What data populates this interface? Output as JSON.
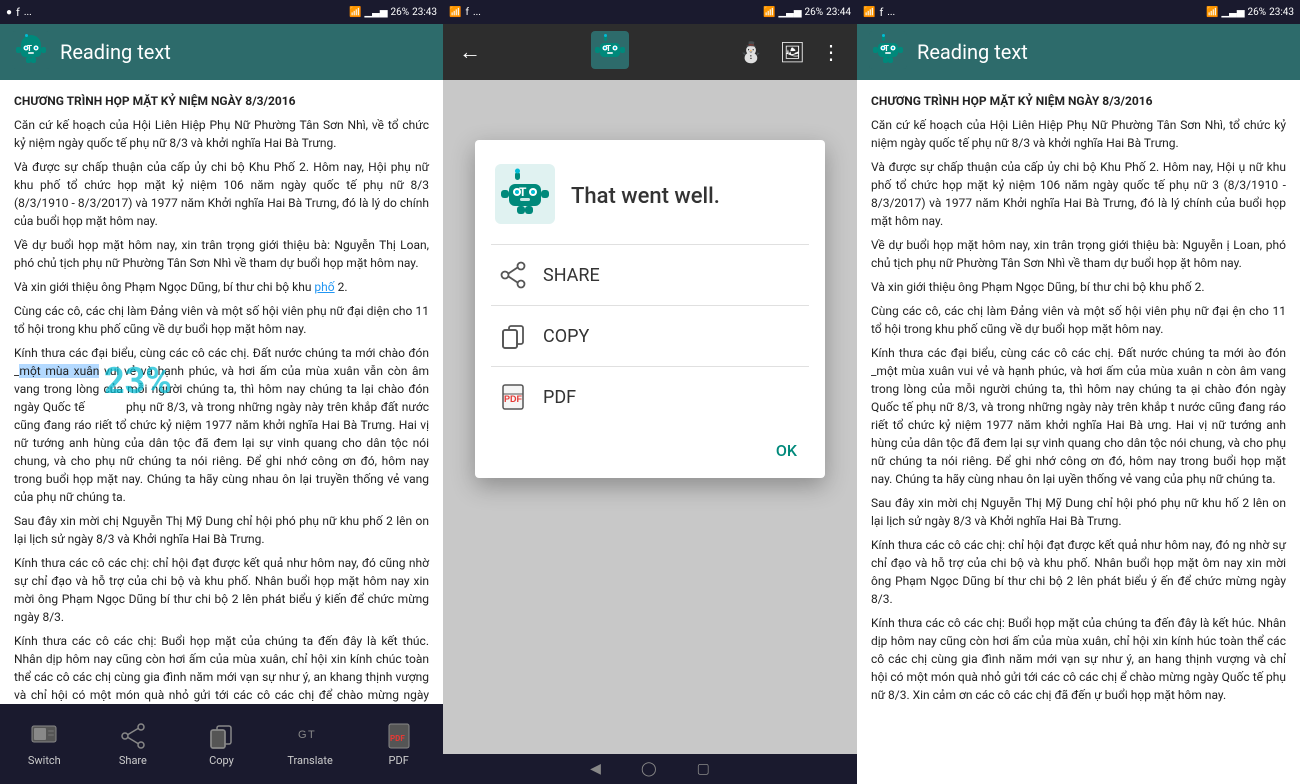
{
  "panels": {
    "left": {
      "status": {
        "left": "● ● ...",
        "time": "23:43",
        "battery": "26%"
      },
      "appbar": {
        "title": "Reading text"
      },
      "content": {
        "title": "CHƯƠNG TRÌNH HỌP MẶT KỶ NIỆM NGÀY 8/3/2016",
        "paragraphs": [
          "Căn cứ kế hoạch của Hội Liên Hiệp Phụ Nữ Phường Tân Sơn Nhì, về tổ chức kỷ niệm ngày quốc tế phụ nữ 8/3 và khởi nghĩa Hai Bà Trưng.",
          "Và được sự chấp thuận của cấp ủy chi bộ Khu Phố 2. Hôm nay, Hội phụ nữ khu phố tổ chức họp mặt kỷ niệm 106 năm ngày quốc tế phụ nữ 8/3 (8/3/1910 - 8/3/2017) và 1977 năm Khởi nghĩa Hai Bà Trưng, đó là lý do chính của buổi họp mặt hôm nay.",
          "Về dự buổi họp mặt hôm nay, xin trân trọng giới thiệu bà: Nguyễn Thị Loan, phó chủ tịch phụ nữ Phường Tân Sơn Nhì về tham dự buổi họp mặt hôm nay.",
          "Và xin giới thiệu ông Phạm Ngọc Dũng, bí thư chi bộ khu phố 2.",
          "Cùng các cô, các chị làm Đảng viên và một số hội viên phụ nữ đại diện cho 11 tổ hội trong khu phố cũng về dự buổi họp mặt hôm nay.",
          "Kính thưa các đại biểu, cùng các cô các chị. Đất nước chúng ta mới chào đón _một mùa xuân vui vẻ và hạnh phúc, và hơi ấm của mùa xuân vẫn còn âm vang trong lòng của mỗi người chúng ta, thì hôm nay chúng ta lại chào đón ngày Quốc tế phụ nữ 8/3, và trong những ngày này trên khắp đất nước cũng đang ráo riết tổ chức kỷ niệm 1977 năm khởi nghĩa Hai Bà Trưng. Hai vị nữ tướng anh hùng của dân tộc đã đem lại sự vinh quang cho dân tộc nói chung, và cho phụ nữ chúng ta nói riêng. Để ghi nhớ công ơn đó, hôm nay trong buổi họp mặt nay. Chúng ta hãy cùng nhau ôn lại truyền thống vẻ vang của phụ nữ chúng ta.",
          "Sau đây xin mời chị Nguyễn Thị Mỹ Dung chỉ hội phó phụ nữ khu phố 2 lên on lại lịch sử ngày 8/3 và Khởi nghĩa Hai Bà Trưng.",
          "Kính thưa các cô các chị: chỉ hội đạt được kết quả như hôm nay, đó cũng nhờ sự chỉ đạo và hỗ trợ của chi bộ và khu phố. Nhân buổi họp mặt hôm nay xin mời ông Phạm Ngọc Dũng bí thư chi bộ 2 lên phát biểu ý kiến để chức mừng ngày 8/3.",
          "Kính thưa các cô các chị: Buổi họp mặt của chúng ta đến đây là kết thúc. Nhân dịp hôm nay cũng còn hơi ấm của mùa xuân, chỉ hội xin kính chúc toàn thể các cô các chị cùng gia đình năm mới vạn sự như ý, an khang thịnh vượng và chỉ hội có một món quà nhỏ gửi tới các cô các chị để chào mừng ngày Quốc tế phụ nữ 8/3. Xin cảm ơn các cô các chị đã đến dự buổi họp mặt hôm nay."
        ]
      },
      "toolbar": {
        "items": [
          {
            "label": "Switch",
            "icon": "switch-icon"
          },
          {
            "label": "Share",
            "icon": "share-icon"
          },
          {
            "label": "Copy",
            "icon": "copy-icon"
          },
          {
            "label": "Translate",
            "icon": "translate-icon"
          },
          {
            "label": "PDF",
            "icon": "pdf-icon"
          }
        ]
      }
    },
    "center": {
      "status": {
        "time": "23:44"
      },
      "dialog": {
        "title": "That went well.",
        "items": [
          {
            "label": "SHARE",
            "icon": "share-icon"
          },
          {
            "label": "COPY",
            "icon": "copy-icon"
          },
          {
            "label": "PDF",
            "icon": "pdf-icon"
          }
        ],
        "ok_label": "OK"
      }
    },
    "right": {
      "status": {
        "time": "23:43"
      },
      "appbar": {
        "title": "Reading text"
      },
      "content": {
        "title": "CHƯƠNG TRÌNH HỌP MẶT KỶ NIỆM NGÀY 8/3/2016",
        "paragraphs": [
          "Căn cứ kế hoạch của Hội Liên Hiệp Phụ Nữ Phường Tân Sơn Nhì, tổ chức kỷ niệm ngày quốc tế phụ nữ 8/3 và khởi nghĩa Hai Bà Trưng.",
          "Và được sự chấp thuận của cấp ủy chi bộ Khu Phố 2. Hôm nay, Hội ụ nữ khu phố tổ chức họp mặt kỷ niệm 106 năm ngày quốc tế phụ nữ 3 (8/3/1910 - 8/3/2017) và 1977 năm Khởi nghĩa Hai Bà Trưng, đó là lý chính của buổi họp mặt hôm nay.",
          "Về dự buổi họp mặt hôm nay, xin trân trọng giới thiệu bà: Nguyễn ị Loan, phó chủ tịch phụ nữ Phường Tân Sơn Nhì về tham dự buổi họp ặt hôm nay.",
          "Và xin giới thiệu ông Phạm Ngọc Dũng, bí thư chi bộ khu phố 2.",
          "Cùng các cô, các chị làm Đảng viên và một số hội viên phụ nữ đại ện cho 11 tổ hội trong khu phố cũng về dự buổi họp mặt hôm nay.",
          "Kính thưa các đại biểu, cùng các cô các chị. Đất nước chúng ta mới ào đón _một mùa xuân vui vẻ và hạnh phúc, và hơi ấm của mùa xuân n còn âm vang trong lòng của mỗi người chúng ta, thì hôm nay chúng ta ại chào đón ngày Quốc tế phụ nữ 8/3, và trong những ngày này trên khắp t nước cũng đang ráo riết tổ chức kỷ niệm 1977 năm khởi nghĩa Hai Bà ưng. Hai vị nữ tướng anh hùng của dân tộc đã đem lại sự vinh quang cho dân tộc nói chung, và cho phụ nữ chúng ta nói riêng. Để ghi nhớ công ơn đó, hôm nay trong buổi họp mặt nay. Chúng ta hãy cùng nhau ôn lại uyền thống vẻ vang của phụ nữ chúng ta.",
          "Sau đây xin mời chị Nguyễn Thị Mỹ Dung chỉ hội phó phụ nữ khu hố 2 lên on lại lịch sử ngày 8/3 và Khởi nghĩa Hai Bà Trưng.",
          "Kính thưa các cô các chị: chỉ hội đạt được kết quả như hôm nay, đó ng nhờ sự chỉ đạo và hỗ trợ của chi bộ và khu phố. Nhân buổi họp mặt ôm nay xin mời ông Phạm Ngọc Dũng bí thư chi bộ 2 lên phát biểu ý ến để chức mừng ngày 8/3.",
          "Kính thưa các cô các chị: Buổi họp mặt của chúng ta đến đây là kết húc. Nhân dịp hôm nay cũng còn hơi ấm của mùa xuân, chỉ hội xin kính húc toàn thể các cô các chị cùng gia đình năm mới vạn sự như ý, an hang thịnh vượng và chỉ hội có một món quà nhỏ gửi tới các cô các chị ể chào mừng ngày Quốc tế phụ nữ 8/3. Xin cảm ơn các cô các chị đã đến ự buổi họp mặt hôm nay."
        ]
      }
    }
  },
  "icons": {
    "robot_color": "#00897b",
    "accent_color": "#00bcd4",
    "toolbar_color": "#1a1a2e"
  }
}
